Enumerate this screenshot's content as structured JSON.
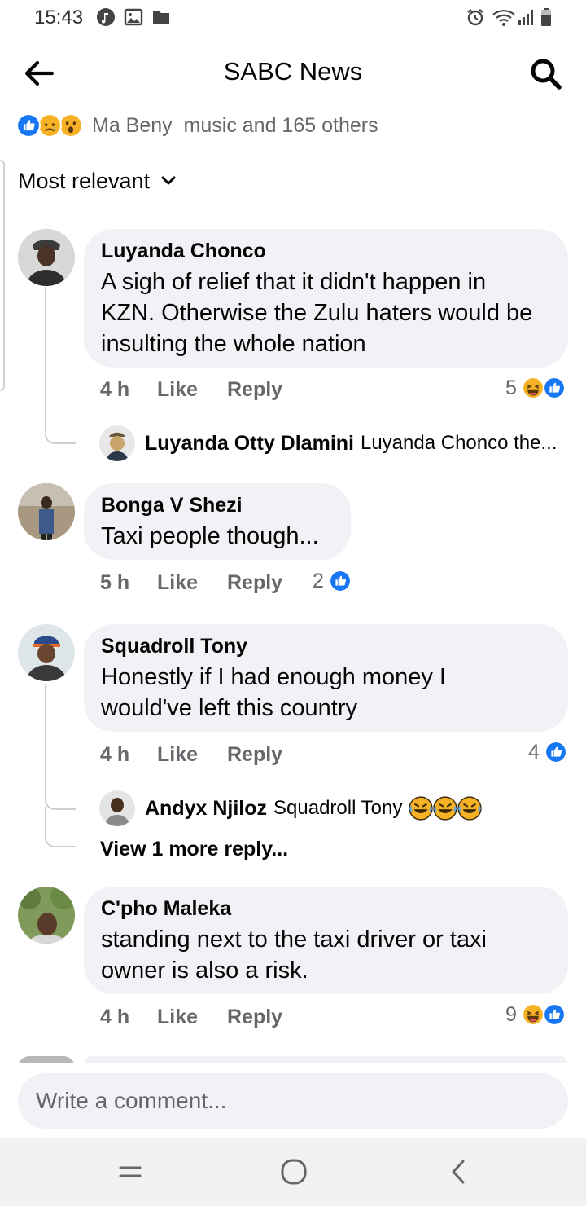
{
  "status_bar": {
    "time": "15:43"
  },
  "header": {
    "title": "SABC News"
  },
  "reactions": {
    "text": "Ma Beny  music and 165 others",
    "icons": [
      "like-reaction",
      "sad-reaction",
      "wow-reaction"
    ]
  },
  "sort": {
    "label": "Most relevant"
  },
  "comments": [
    {
      "name": "Luyanda Chonco",
      "lines": [
        "A sigh of relief that it didn't happen in",
        "KZN. Otherwise the Zulu haters would be",
        "insulting the whole nation"
      ],
      "time": "4 h",
      "like": "Like",
      "reply": "Reply",
      "reaction_count": "5",
      "replies": [
        {
          "name": "Luyanda Otty Dlamini",
          "text": "Luyanda Chonco the..."
        }
      ]
    },
    {
      "name": "Bonga V Shezi",
      "lines": [
        "Taxi people though..."
      ],
      "time": "5 h",
      "like": "Like",
      "reply": "Reply",
      "reaction_count": "2"
    },
    {
      "name": "Squadroll Tony",
      "lines": [
        "Honestly if I had enough money I",
        "would've left this country"
      ],
      "time": "4 h",
      "like": "Like",
      "reply": "Reply",
      "reaction_count": "4",
      "replies": [
        {
          "name": "Andyx Njiloz",
          "text": "Squadroll Tony"
        }
      ],
      "view_more": "View 1 more reply..."
    },
    {
      "name": "C'pho Maleka",
      "lines": [
        "standing next to the taxi driver or taxi",
        "owner is also a risk."
      ],
      "time": "4 h",
      "like": "Like",
      "reply": "Reply",
      "reaction_count": "9"
    }
  ],
  "composer": {
    "placeholder": "Write a comment..."
  },
  "colors": {
    "like_blue": "#1877f2",
    "haha_yellow": "#f7b125",
    "bubble_gray": "#f0f2f5",
    "meta_gray": "#65676b"
  }
}
